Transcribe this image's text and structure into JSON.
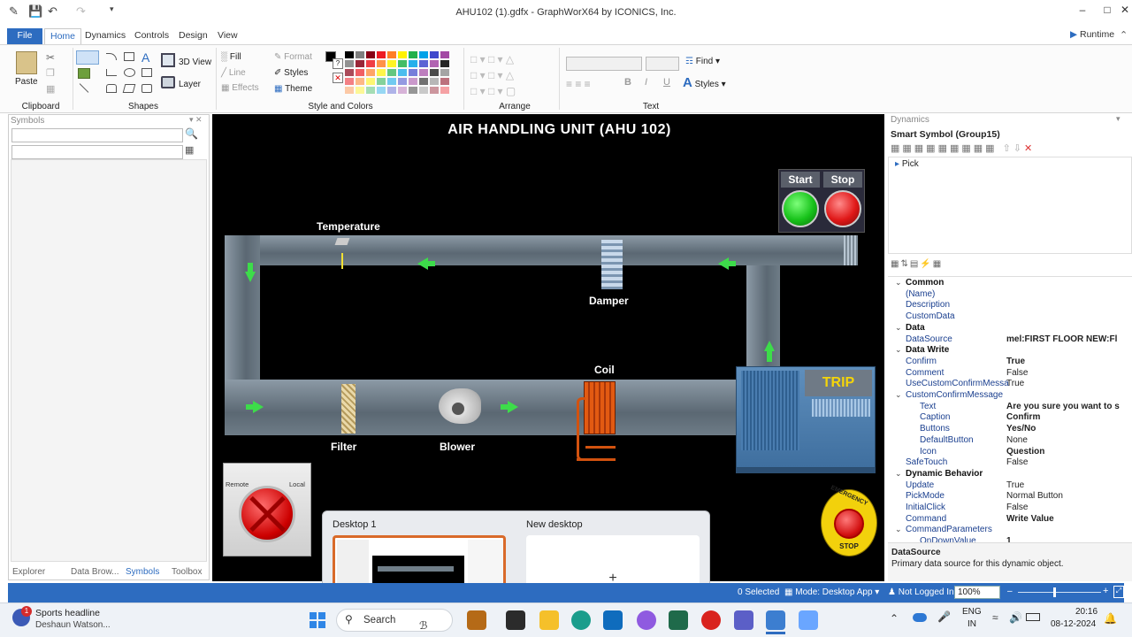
{
  "window": {
    "title": "AHU102 (1).gdfx - GraphWorX64 by ICONICS, Inc.",
    "minimize": "–",
    "maximize": "□",
    "close": "✕"
  },
  "menu_tabs": [
    "File",
    "Home",
    "Dynamics",
    "Controls",
    "Design",
    "View"
  ],
  "runtime_label": "Runtime",
  "ribbon": {
    "clipboard": {
      "label": "Clipboard",
      "paste": "Paste"
    },
    "shapes": {
      "label": "Shapes",
      "view3d": "3D View",
      "layer": "Layer"
    },
    "style": {
      "label": "Style and Colors",
      "fill": "Fill",
      "line": "Line",
      "effects": "Effects",
      "format": "Format",
      "styles": "Styles",
      "theme": "Theme"
    },
    "arrange": {
      "label": "Arrange"
    },
    "text": {
      "label": "Text",
      "find": "Find",
      "styles": "Styles",
      "bold": "B",
      "italic": "I",
      "underline": "U"
    }
  },
  "symbols_panel": {
    "title": "Symbols",
    "tabs": [
      "Explorer",
      "Data Brow...",
      "Symbols",
      "Toolbox"
    ]
  },
  "canvas": {
    "title": "AIR HANDLING UNIT (AHU 102)",
    "start": "Start",
    "stop": "Stop",
    "temperature": "Temperature",
    "damper": "Damper",
    "coil": "Coil",
    "filter": "Filter",
    "blower": "Blower",
    "trip": "TRIP",
    "remote": "Remote",
    "local": "Local",
    "emergency_top": "EMERGENCY",
    "emergency_bottom": "STOP"
  },
  "desktop_switcher": {
    "desktop1": "Desktop 1",
    "new_desktop": "New desktop",
    "plus": "+"
  },
  "dynamics_panel": {
    "title": "Dynamics",
    "subtitle": "Smart Symbol (Group15)",
    "pick": "Pick",
    "rows": [
      {
        "type": "cat",
        "name": "Common",
        "value": ""
      },
      {
        "type": "prop",
        "name": "(Name)",
        "value": ""
      },
      {
        "type": "prop",
        "name": "Description",
        "value": ""
      },
      {
        "type": "prop",
        "name": "CustomData",
        "value": ""
      },
      {
        "type": "cat",
        "name": "Data",
        "value": ""
      },
      {
        "type": "prop",
        "name": "DataSource",
        "value": "mel:FIRST FLOOR NEW:Fl"
      },
      {
        "type": "cat",
        "name": "Data Write",
        "value": ""
      },
      {
        "type": "prop",
        "name": "Confirm",
        "value": "True"
      },
      {
        "type": "prop",
        "name": "Comment",
        "value": "False"
      },
      {
        "type": "prop",
        "name": "UseCustomConfirmMessa",
        "value": "True"
      },
      {
        "type": "sub",
        "name": "CustomConfirmMessage",
        "value": ""
      },
      {
        "type": "prop2",
        "name": "Text",
        "value": "Are you sure you want to s"
      },
      {
        "type": "prop2",
        "name": "Caption",
        "value": "Confirm"
      },
      {
        "type": "prop2",
        "name": "Buttons",
        "value": "Yes/No"
      },
      {
        "type": "prop2",
        "name": "DefaultButton",
        "value": "None"
      },
      {
        "type": "prop2",
        "name": "Icon",
        "value": "Question"
      },
      {
        "type": "prop",
        "name": "SafeTouch",
        "value": "False"
      },
      {
        "type": "cat",
        "name": "Dynamic Behavior",
        "value": ""
      },
      {
        "type": "prop",
        "name": "Update",
        "value": "True"
      },
      {
        "type": "prop",
        "name": "PickMode",
        "value": "Normal Button"
      },
      {
        "type": "prop",
        "name": "InitialClick",
        "value": "False"
      },
      {
        "type": "prop",
        "name": "Command",
        "value": "Write Value"
      },
      {
        "type": "sub",
        "name": "CommandParameters",
        "value": ""
      },
      {
        "type": "prop2",
        "name": "OnDownValue",
        "value": "1"
      }
    ],
    "help_title": "DataSource",
    "help_text": "Primary data source for this dynamic object."
  },
  "statusbar": {
    "selected": "0 Selected",
    "mode": "Mode: Desktop App",
    "login": "Not Logged In",
    "zoom": "100%"
  },
  "taskbar": {
    "news_title": "Sports headline",
    "news_sub": "Deshaun Watson...",
    "news_badge": "1",
    "search": "Search",
    "lang1": "ENG",
    "lang2": "IN",
    "time": "20:16",
    "date": "08-12-2024"
  },
  "colors": {
    "accent": "#2d6cc0",
    "start_green": "#17c21a",
    "stop_red": "#e01818",
    "arrow_green": "#3ddc4a",
    "coil_orange": "#e25a12"
  }
}
